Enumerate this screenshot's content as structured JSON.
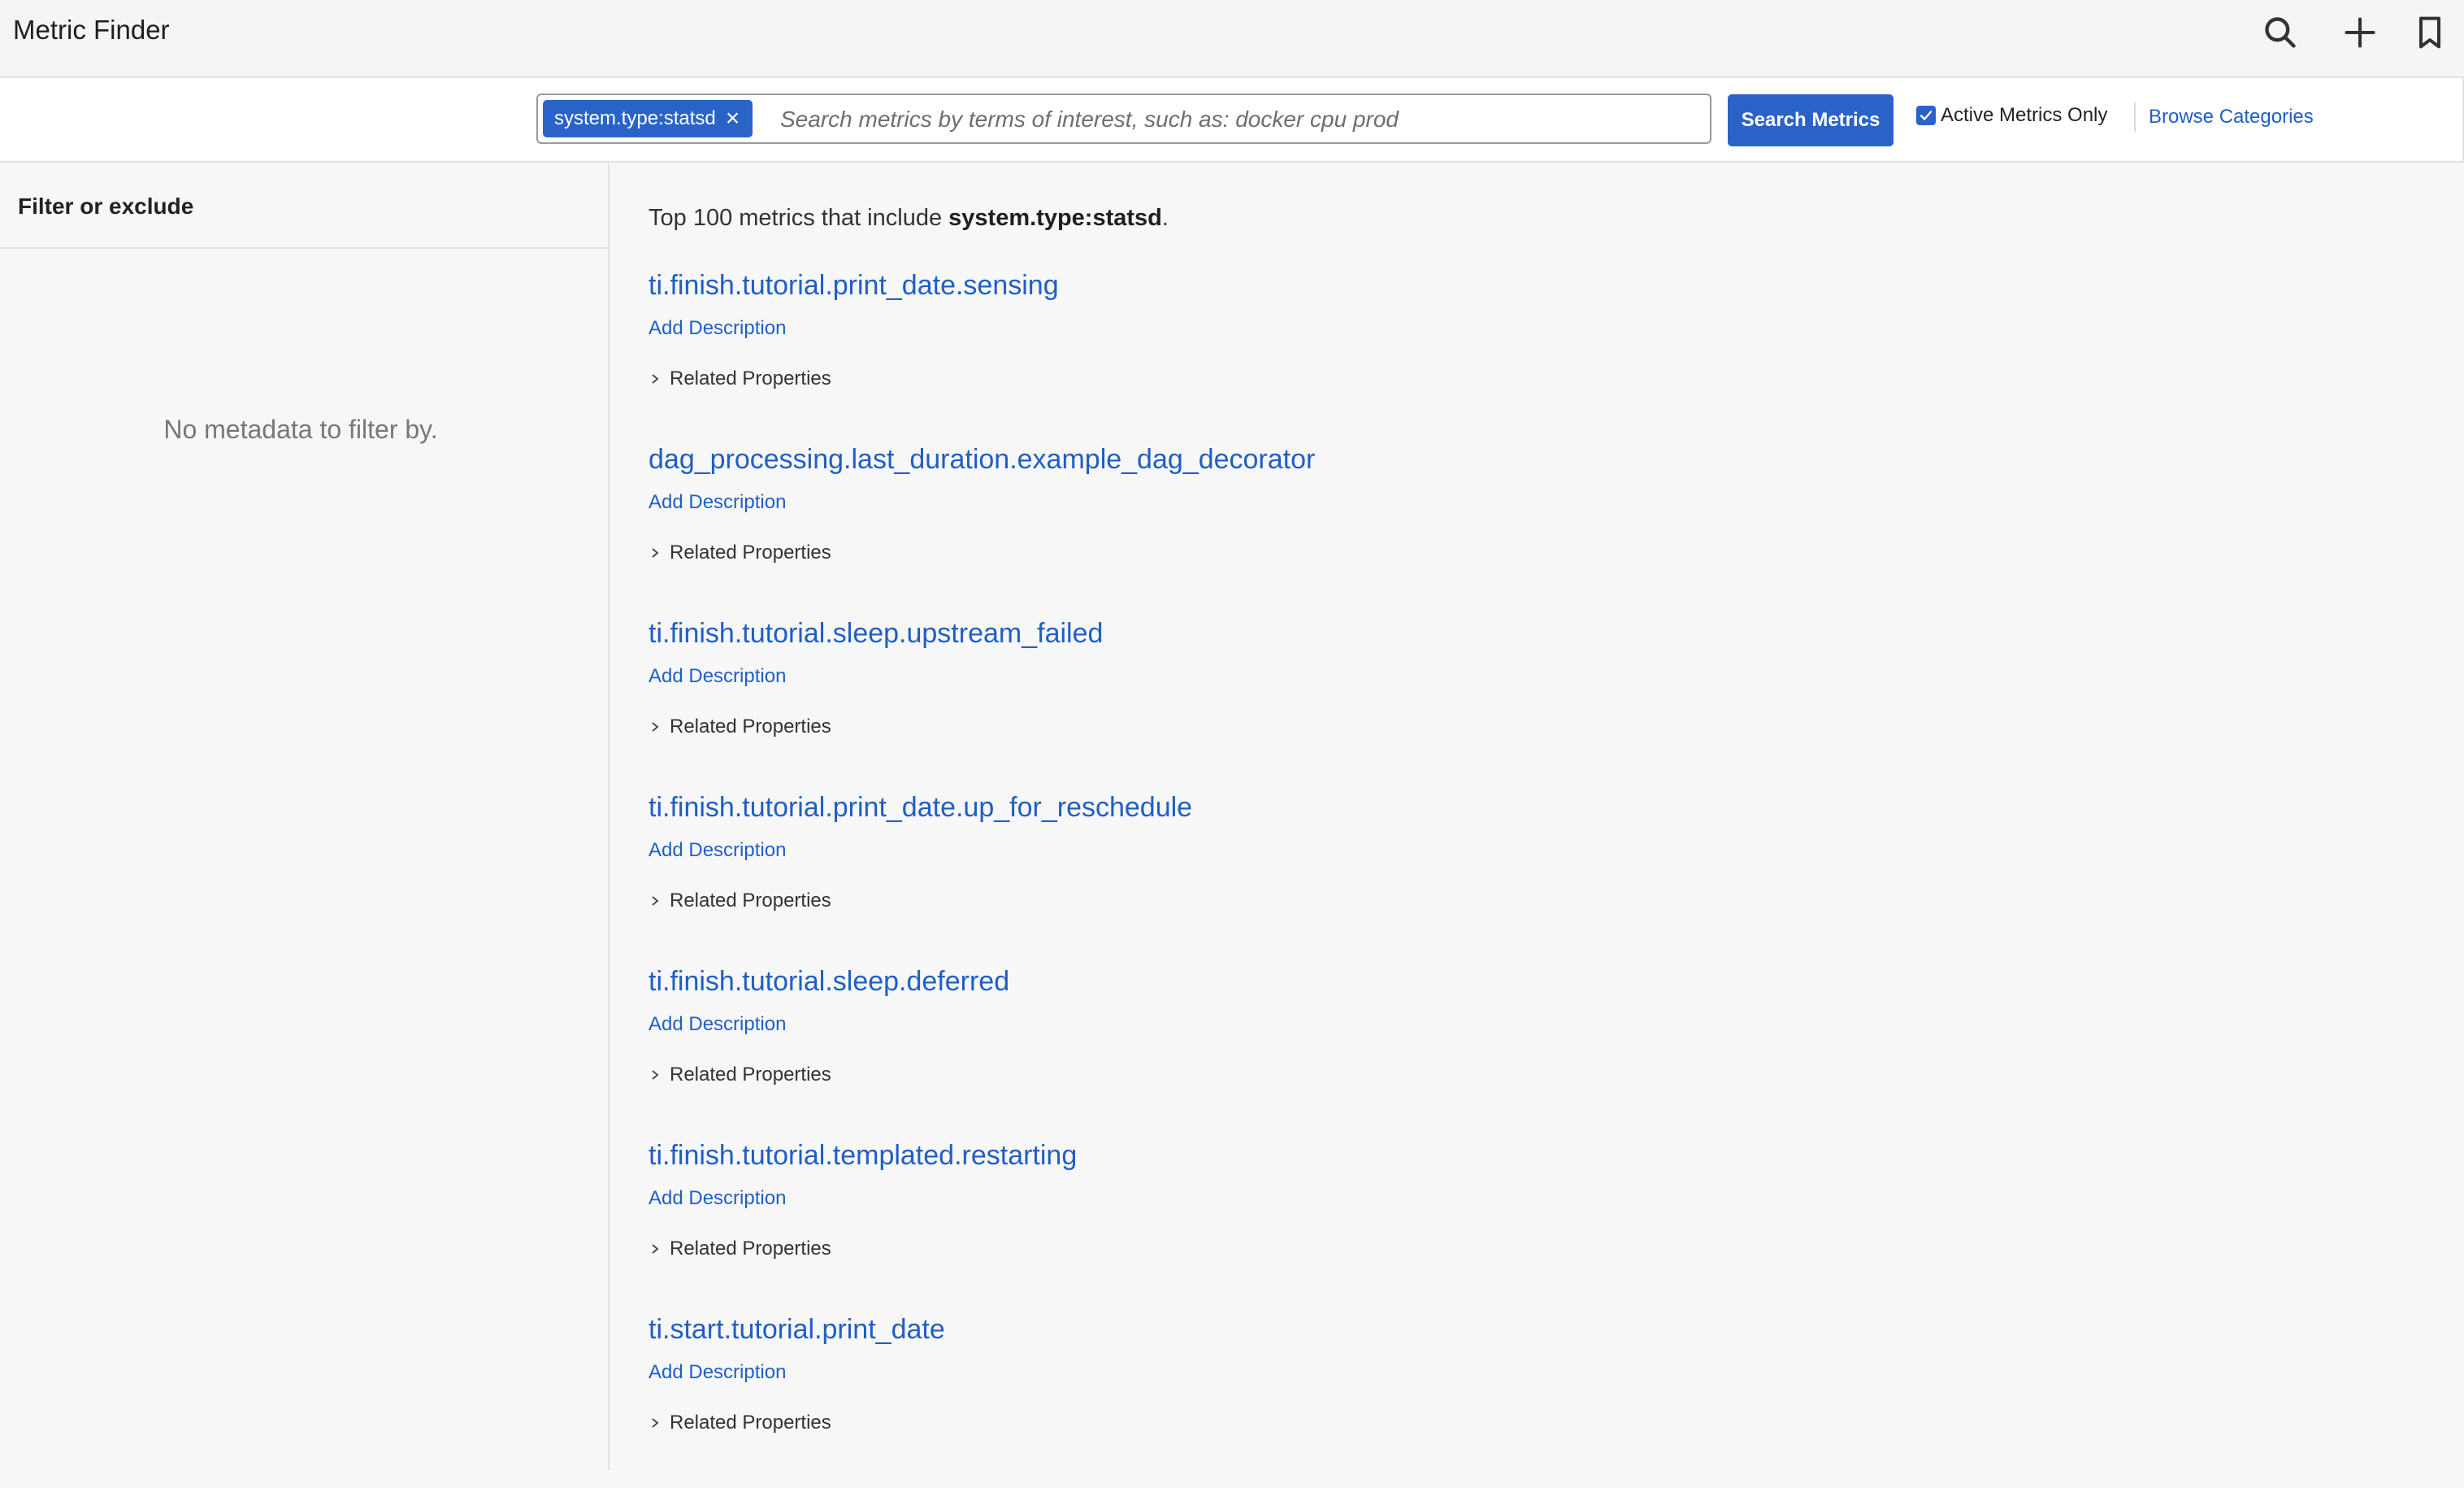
{
  "header": {
    "title": "Metric Finder",
    "icons": [
      "search-icon",
      "plus-icon",
      "bookmark-icon"
    ]
  },
  "search": {
    "token_label": "system.type:statsd",
    "placeholder": "Search metrics by terms of interest, such as: docker cpu prod",
    "value": "",
    "button_label": "Search Metrics",
    "active_only_label": "Active Metrics Only",
    "active_only_checked": true,
    "browse_label": "Browse Categories"
  },
  "sidebar": {
    "heading": "Filter or exclude",
    "empty_message": "No metadata to filter by."
  },
  "results": {
    "summary_prefix": "Top 100 metrics that include ",
    "summary_term": "system.type:statsd",
    "summary_suffix": ".",
    "add_description_label": "Add Description",
    "related_label": "Related Properties",
    "metrics": [
      {
        "name": "ti.finish.tutorial.print_date.sensing"
      },
      {
        "name": "dag_processing.last_duration.example_dag_decorator"
      },
      {
        "name": "ti.finish.tutorial.sleep.upstream_failed"
      },
      {
        "name": "ti.finish.tutorial.print_date.up_for_reschedule"
      },
      {
        "name": "ti.finish.tutorial.sleep.deferred"
      },
      {
        "name": "ti.finish.tutorial.templated.restarting"
      },
      {
        "name": "ti.start.tutorial.print_date"
      }
    ]
  },
  "colors": {
    "accent": "#2a63c7",
    "link": "#1f5fc5"
  }
}
